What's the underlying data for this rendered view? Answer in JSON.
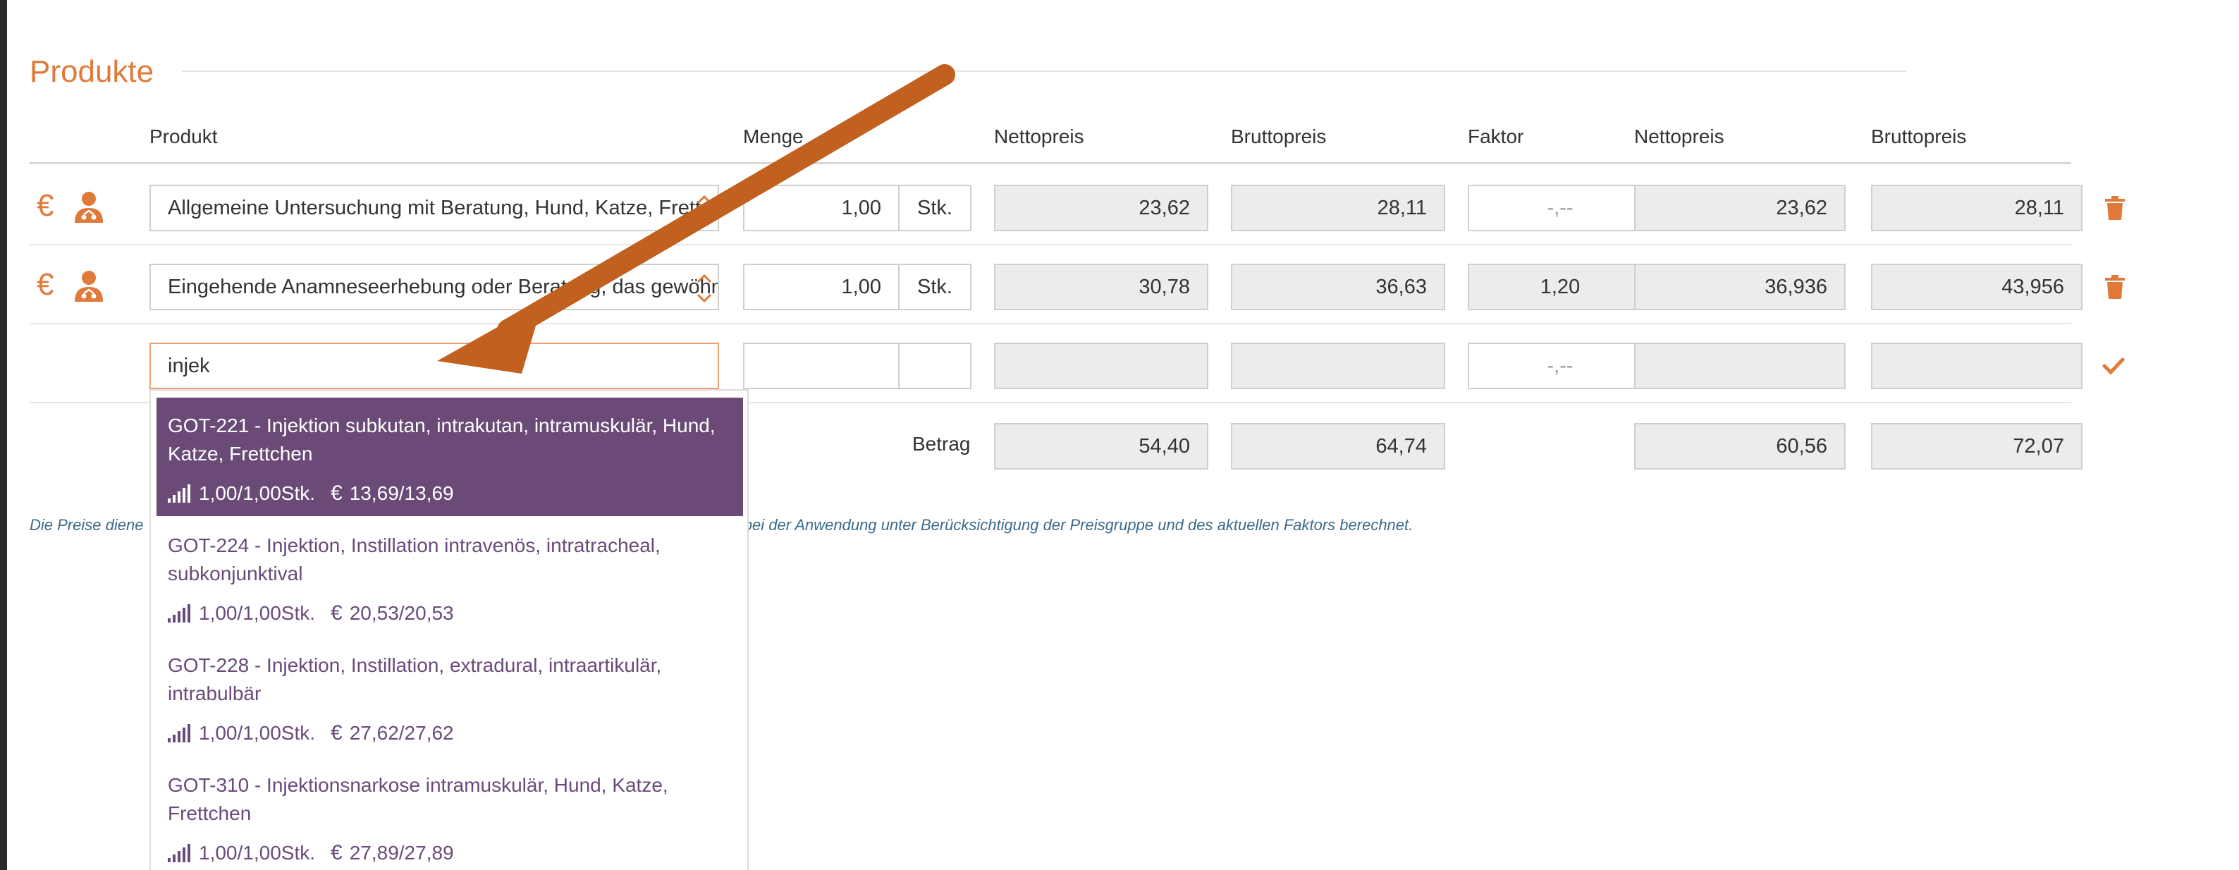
{
  "section": {
    "title": "Produkte"
  },
  "headers": {
    "produkt": "Produkt",
    "menge": "Menge",
    "netto1": "Nettopreis",
    "brutto1": "Bruttopreis",
    "faktor": "Faktor",
    "netto2": "Nettopreis",
    "brutto2": "Bruttopreis"
  },
  "rows": [
    {
      "product": "Allgemeine Untersuchung mit Beratung, Hund, Katze, Frettchen",
      "menge": "1,00",
      "unit": "Stk.",
      "netto": "23,62",
      "brutto": "28,11",
      "faktor": "-,--",
      "netto_total": "23,62",
      "brutto_total": "28,11"
    },
    {
      "product": "Eingehende Anamneseerhebung oder Beratung, das gewöhnliche Maß übersteigend",
      "menge": "1,00",
      "unit": "Stk.",
      "netto": "30,78",
      "brutto": "36,63",
      "faktor": "1,20",
      "netto_total": "36,936",
      "brutto_total": "43,956"
    }
  ],
  "new_row": {
    "product_value": "injek",
    "faktor_placeholder": "-,--"
  },
  "totals": {
    "label": "Betrag",
    "netto": "54,40",
    "brutto": "64,74",
    "netto_total": "60,56",
    "brutto_total": "72,07"
  },
  "note": "Die Preise dienen … werden erst bei der Anwendung unter Berücksichtigung der Preisgruppe und des aktuellen Faktors berechnet.",
  "note_left": "Die Preise diene",
  "note_right": "en erst bei der Anwendung unter Berücksichtigung der Preisgruppe und des aktuellen Faktors berechnet.",
  "suggestions": [
    {
      "name": "GOT-221 - Injektion subkutan, intrakutan, intramuskulär, Hund, Katze, Frettchen",
      "qty": "1,00/1,00Stk.",
      "currency": "€",
      "price": "13,69/13,69",
      "active": true
    },
    {
      "name": "GOT-224 - Injektion, Instillation intravenös, intratracheal, subkonjunktival",
      "qty": "1,00/1,00Stk.",
      "currency": "€",
      "price": "20,53/20,53",
      "active": false
    },
    {
      "name": "GOT-228 - Injektion, Instillation, extradural, intraartikulär, intrabulbär",
      "qty": "1,00/1,00Stk.",
      "currency": "€",
      "price": "27,62/27,62",
      "active": false
    },
    {
      "name": "GOT-310 - Injektionsnarkose intramuskulär, Hund, Katze, Frettchen",
      "qty": "1,00/1,00Stk.",
      "currency": "€",
      "price": "27,89/27,89",
      "active": false
    }
  ],
  "icons": {
    "euro": "€",
    "euro_color": "#e07a3a",
    "accent": "#e07a3a",
    "dropdown_active": "#6b4a78",
    "arrow_color": "#c2611f"
  }
}
